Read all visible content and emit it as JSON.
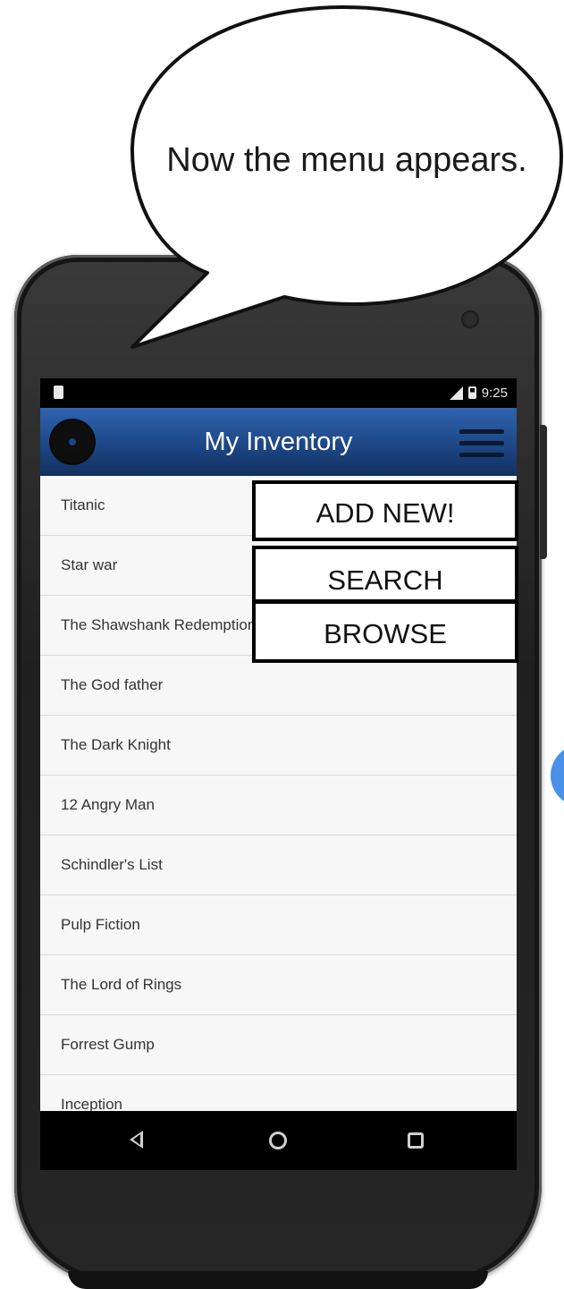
{
  "callout": {
    "text": "Now the menu appears."
  },
  "status_bar": {
    "time": "9:25"
  },
  "app_bar": {
    "title": "My Inventory"
  },
  "movies": [
    "Titanic",
    "Star war",
    "The Shawshank Redemption",
    "The God father",
    "The Dark Knight",
    "12 Angry Man",
    "Schindler's List",
    "Pulp Fiction",
    "The Lord of Rings",
    "Forrest Gump",
    "Inception"
  ],
  "menu": {
    "add_new": "ADD NEW!",
    "search": "SEARCH",
    "browse": "BROWSE"
  },
  "colors": {
    "app_bar": "#1d4786",
    "fab": "#4a90e8"
  },
  "icons": {
    "app_logo": "vinyl-disc-icon",
    "menu": "hamburger-menu-icon",
    "nav_back": "back-triangle-icon",
    "nav_home": "home-circle-icon",
    "nav_recent": "recent-apps-square-icon"
  }
}
